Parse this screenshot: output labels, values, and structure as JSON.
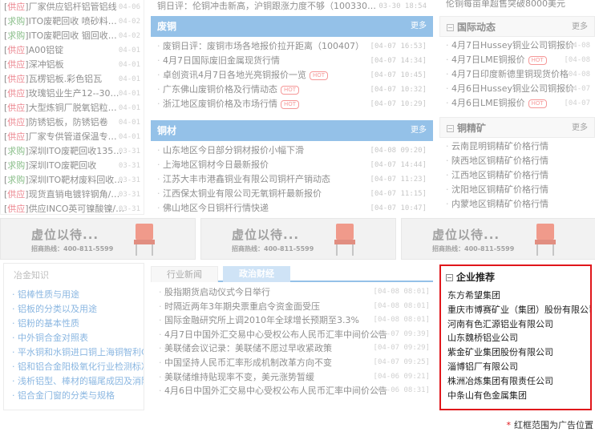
{
  "left_list": [
    {
      "tag": "供应",
      "tag_type": "supply",
      "text": "厂家供应铝杆铝管铝线",
      "date": "04-06"
    },
    {
      "tag": "求购",
      "tag_type": "buy",
      "text": "ITO废靶回收 喷砂料…",
      "date": "04-02"
    },
    {
      "tag": "求购",
      "tag_type": "buy",
      "text": "ITO废靶回收 铟回收…",
      "date": "04-02"
    },
    {
      "tag": "供应",
      "tag_type": "supply",
      "text": "A00铝锭",
      "date": "04-01"
    },
    {
      "tag": "供应",
      "tag_type": "supply",
      "text": "深冲铝板",
      "date": "04-01"
    },
    {
      "tag": "供应",
      "tag_type": "supply",
      "text": "瓦楞铝板.彩色铝瓦",
      "date": "04-01"
    },
    {
      "tag": "供应",
      "tag_type": "supply",
      "text": "玫瑰铝业生产12--30…",
      "date": "04-01"
    },
    {
      "tag": "供应",
      "tag_type": "supply",
      "text": "大型炼铜厂脱氧铝粒…",
      "date": "04-01"
    },
    {
      "tag": "供应",
      "tag_type": "supply",
      "text": "防锈铝板，防锈铝卷",
      "date": "04-01"
    },
    {
      "tag": "供应",
      "tag_type": "supply",
      "text": "厂家专供管道保温专…",
      "date": "04-01"
    },
    {
      "tag": "求购",
      "tag_type": "buy",
      "text": "深圳ITO废靶回收135…",
      "date": "03-31"
    },
    {
      "tag": "求购",
      "tag_type": "buy",
      "text": "深圳ITO废靶回收",
      "date": "03-31"
    },
    {
      "tag": "求购",
      "tag_type": "buy",
      "text": "深圳ITO靶材废料回收…",
      "date": "03-31"
    },
    {
      "tag": "供应",
      "tag_type": "supply",
      "text": "现货直销电镀锌钢角/…",
      "date": "03-31"
    },
    {
      "tag": "供应",
      "tag_type": "supply",
      "text": "供应INCO英可镍酸镍/…",
      "date": "03-31"
    }
  ],
  "top_mid_row": {
    "text": "铜日评：伦铜冲击新高，沪铜跟涨力度不够（100330…",
    "date": "03-30 18:54"
  },
  "waste_copper": {
    "title": "废铜",
    "more": "更多",
    "items": [
      {
        "text": "废铜日评：废铜市场各地报价拉开距离（100407）",
        "date": "[04-07 16:53]",
        "hot": false
      },
      {
        "text": "4月7日国际废旧金属现货行情",
        "date": "[04-07 14:34]",
        "hot": false
      },
      {
        "text": "卓创资讯4月7日各地光亮铜报价一览",
        "date": "[04-07 10:45]",
        "hot": true
      },
      {
        "text": "广东佛山废铜价格及行情动态",
        "date": "[04-07 10:32]",
        "hot": true
      },
      {
        "text": "浙江地区废铜价格及市场行情",
        "date": "[04-07 10:29]",
        "hot": true
      }
    ]
  },
  "copper_products": {
    "title": "铜材",
    "more": "更多",
    "items": [
      {
        "text": "山东地区今日部分铜材报价小幅下滑",
        "date": "[04-08 09:20]"
      },
      {
        "text": "上海地区铜材今日最新报价",
        "date": "[04-07 14:44]"
      },
      {
        "text": "江苏大丰市港鑫铜业有限公司铜杆产销动态",
        "date": "[04-07 11:23]"
      },
      {
        "text": "江西保太铜业有限公司无氧铜杆最新报价",
        "date": "[04-07 11:15]"
      },
      {
        "text": "佛山地区今日铜杆行情快递",
        "date": "[04-07 10:47]"
      }
    ]
  },
  "top_right_row": {
    "text": "伦铜每亩单超售突破8000美元"
  },
  "intl": {
    "title": "国际动态",
    "more": "更多",
    "items": [
      {
        "text": "4月7日Hussey铜业公司铜报价",
        "date": "[04-08"
      },
      {
        "text": "4月7日LME铜报价",
        "date": "[04-08",
        "hot": true
      },
      {
        "text": "4月7日印度新德里铜现货价格",
        "date": "[04-08"
      },
      {
        "text": "4月6日Hussey铜业公司铜报价",
        "date": "[04-07"
      },
      {
        "text": "4月6日LME铜报价",
        "date": "[04-07",
        "hot": true
      }
    ]
  },
  "concentrate": {
    "title": "铜精矿",
    "more": "更多",
    "items": [
      {
        "text": "云南昆明铜精矿价格行情"
      },
      {
        "text": "陕西地区铜精矿价格行情"
      },
      {
        "text": "江西地区铜精矿价格行情"
      },
      {
        "text": "沈阳地区铜精矿价格行情"
      },
      {
        "text": "内蒙地区铜精矿价格行情"
      }
    ]
  },
  "ads": [
    {
      "title": "虚位以待...",
      "hotline": "招商热线：400-811-5599"
    },
    {
      "title": "虚位以待...",
      "hotline": "招商热线：400-811-5599"
    },
    {
      "title": "虚位以待...",
      "hotline": "招商热线：400-811-5599"
    }
  ],
  "knowledge": {
    "title": "冶金知识",
    "items": [
      "铝棒性质与用途",
      "铝板的分类以及用途",
      "铝粉的基本性质",
      "中外铜合金对照表",
      "平水铜和水铜进口铜上海铜智利C",
      "铝和铝合金阳极氧化行业检测标准",
      "浅析铝型、棒材的辐尾成因及消除",
      "铝合金门窗的分类与规格"
    ]
  },
  "news": {
    "tabs": [
      "行业新闻",
      "政治财经"
    ],
    "items": [
      {
        "text": "股指期货启动仪式今日举行",
        "date": "[04-08 08:01]"
      },
      {
        "text": "时隔近两年3年期央票重启令资金面受压",
        "date": "[04-08 08:01]"
      },
      {
        "text": "国际金融研究所上调2010年全球增长预期至3.3%",
        "date": "[04-08 08:01]"
      },
      {
        "text": "4月7日中国外汇交易中心受权公布人民币汇率中间价公告",
        "date": "[04-07 09:39]"
      },
      {
        "text": "美联储会议记录：美联储不愿过早收紧政策",
        "date": "[04-07 09:29]"
      },
      {
        "text": "中国坚持人民币汇率形成机制改革方向不变",
        "date": "[04-07 09:25]"
      },
      {
        "text": "美联储维持贴现率不变，美元涨势暂缓",
        "date": "[04-06 09:21]"
      },
      {
        "text": "4月6日中国外汇交易中心受权公布人民币汇率中间价公告",
        "date": "[04-06 08:31]"
      }
    ]
  },
  "recommend": {
    "title": "企业推荐",
    "items": [
      "东方希望集团",
      "重庆市博赛矿业（集团）股份有限公司",
      "河南有色汇源铝业有限公司",
      "山东魏桥铝业公司",
      "紫金矿业集团股份有限公司",
      "淄博铝厂有限公司",
      "株洲冶炼集团有限责任公司",
      "中条山有色金属集团"
    ]
  },
  "note": "红框范围为广告位置",
  "colors": {
    "accent": "#3d8fd7",
    "highlight_border": "#e0161b",
    "link": "#2b7cc9"
  }
}
